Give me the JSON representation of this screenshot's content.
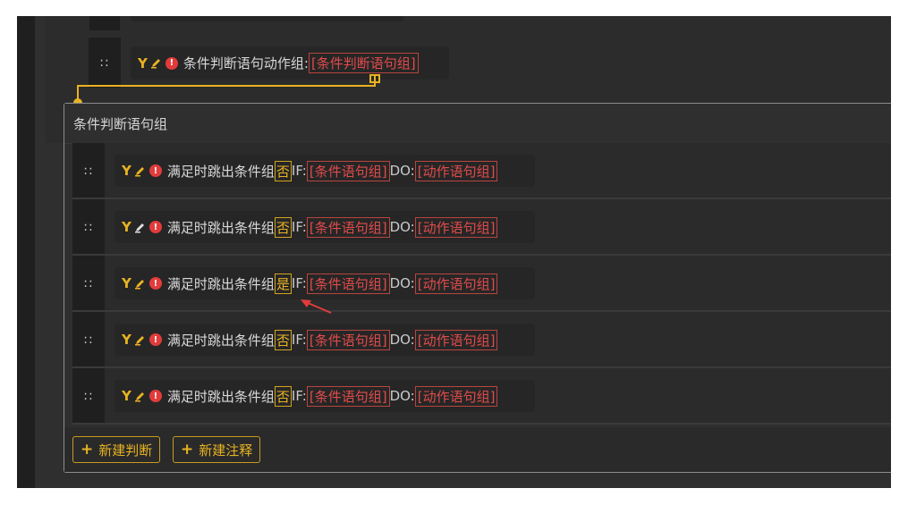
{
  "top_statement": {
    "prefix": "条件判断语句动作组:",
    "link": "[条件判断语句组]"
  },
  "group": {
    "title": "条件判断语句组",
    "rows": [
      {
        "text": "满足时跳出条件组",
        "flag": "否",
        "if_label": "IF:",
        "cond": "[条件语句组]",
        "do_label": "DO:",
        "action": "[动作语句组]"
      },
      {
        "text": "满足时跳出条件组",
        "flag": "否",
        "if_label": "IF:",
        "cond": "[条件语句组]",
        "do_label": "DO:",
        "action": "[动作语句组]"
      },
      {
        "text": "满足时跳出条件组",
        "flag": "是",
        "if_label": "IF:",
        "cond": "[条件语句组]",
        "do_label": "DO:",
        "action": "[动作语句组]"
      },
      {
        "text": "满足时跳出条件组",
        "flag": "否",
        "if_label": "IF:",
        "cond": "[条件语句组]",
        "do_label": "DO:",
        "action": "[动作语句组]"
      },
      {
        "text": "满足时跳出条件组",
        "flag": "否",
        "if_label": "IF:",
        "cond": "[条件语句组]",
        "do_label": "DO:",
        "action": "[动作语句组]"
      }
    ],
    "buttons": {
      "new_condition": "新建判断",
      "new_comment": "新建注释"
    }
  },
  "icons": {
    "drag": "drag-handle-icon",
    "fork": "fork-icon",
    "edit": "pencil-icon",
    "alert": "alert-icon",
    "plus": "plus-icon"
  },
  "colors": {
    "background": "#2f2f2f",
    "accent_gold": "#e8b321",
    "link_red": "#e14b4b",
    "alert_red": "#e23b3b",
    "arrow_annotation": "#e23b3b"
  }
}
